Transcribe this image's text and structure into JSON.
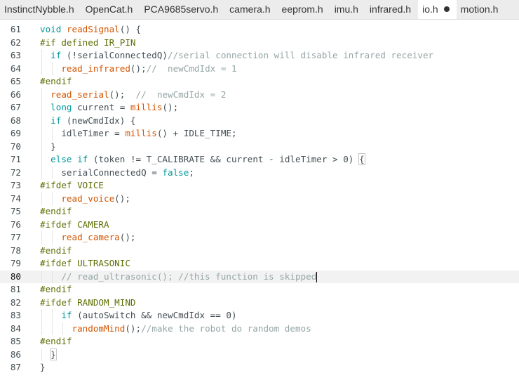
{
  "tabs": [
    {
      "label": "InstinctNybble.h",
      "active": false
    },
    {
      "label": "OpenCat.h",
      "active": false
    },
    {
      "label": "PCA9685servo.h",
      "active": false
    },
    {
      "label": "camera.h",
      "active": false
    },
    {
      "label": "eeprom.h",
      "active": false
    },
    {
      "label": "imu.h",
      "active": false
    },
    {
      "label": "infrared.h",
      "active": false
    },
    {
      "label": "io.h",
      "active": true,
      "modified": true
    },
    {
      "label": "motion.h",
      "active": false
    }
  ],
  "colors": {
    "keyword": "#00979c",
    "function": "#d35400",
    "preprocessor": "#5e6d03",
    "comment": "#95a5a6",
    "text": "#434f54",
    "current_line": "#f2f2f2"
  },
  "editor": {
    "current_line": 80,
    "lines": [
      {
        "n": "61",
        "indent": 0,
        "tokens": [
          [
            "kw",
            "void"
          ],
          [
            "t",
            " "
          ],
          [
            "fn",
            "readSignal"
          ],
          [
            "t",
            "() {"
          ]
        ]
      },
      {
        "n": "62",
        "indent": 0,
        "tokens": [
          [
            "pp",
            "#if defined IR_PIN"
          ]
        ]
      },
      {
        "n": "63",
        "indent": 1,
        "tokens": [
          [
            "kw",
            "if"
          ],
          [
            "t",
            " (!serialConnectedQ)"
          ],
          [
            "cm",
            "//serial connection will disable infrared receiver"
          ]
        ]
      },
      {
        "n": "64",
        "indent": 2,
        "tokens": [
          [
            "fn",
            "read_infrared"
          ],
          [
            "t",
            "();"
          ],
          [
            "cm",
            "//  newCmdIdx = 1"
          ]
        ]
      },
      {
        "n": "65",
        "indent": 0,
        "tokens": [
          [
            "pp",
            "#endif"
          ]
        ]
      },
      {
        "n": "66",
        "indent": 1,
        "tokens": [
          [
            "fn",
            "read_serial"
          ],
          [
            "t",
            "();  "
          ],
          [
            "cm",
            "//  newCmdIdx = 2"
          ]
        ]
      },
      {
        "n": "67",
        "indent": 1,
        "tokens": [
          [
            "kw",
            "long"
          ],
          [
            "t",
            " current = "
          ],
          [
            "fn",
            "millis"
          ],
          [
            "t",
            "();"
          ]
        ]
      },
      {
        "n": "68",
        "indent": 1,
        "tokens": [
          [
            "kw",
            "if"
          ],
          [
            "t",
            " (newCmdIdx) {"
          ]
        ]
      },
      {
        "n": "69",
        "indent": 2,
        "tokens": [
          [
            "t",
            "idleTimer = "
          ],
          [
            "fn",
            "millis"
          ],
          [
            "t",
            "() + IDLE_TIME;"
          ]
        ]
      },
      {
        "n": "70",
        "indent": 1,
        "tokens": [
          [
            "t",
            "}"
          ]
        ]
      },
      {
        "n": "71",
        "indent": 1,
        "tokens": [
          [
            "kw",
            "else"
          ],
          [
            "t",
            " "
          ],
          [
            "kw",
            "if"
          ],
          [
            "t",
            " (token != T_CALIBRATE && current - idleTimer > 0) "
          ],
          [
            "br",
            "{"
          ]
        ]
      },
      {
        "n": "72",
        "indent": 2,
        "tokens": [
          [
            "t",
            "serialConnectedQ = "
          ],
          [
            "kw",
            "false"
          ],
          [
            "t",
            ";"
          ]
        ]
      },
      {
        "n": "73",
        "indent": 0,
        "tokens": [
          [
            "pp",
            "#ifdef VOICE"
          ]
        ]
      },
      {
        "n": "74",
        "indent": 2,
        "tokens": [
          [
            "fn",
            "read_voice"
          ],
          [
            "t",
            "();"
          ]
        ]
      },
      {
        "n": "75",
        "indent": 0,
        "tokens": [
          [
            "pp",
            "#endif"
          ]
        ]
      },
      {
        "n": "76",
        "indent": 0,
        "tokens": [
          [
            "pp",
            "#ifdef CAMERA"
          ]
        ]
      },
      {
        "n": "77",
        "indent": 2,
        "tokens": [
          [
            "fn",
            "read_camera"
          ],
          [
            "t",
            "();"
          ]
        ]
      },
      {
        "n": "78",
        "indent": 0,
        "tokens": [
          [
            "pp",
            "#endif"
          ]
        ]
      },
      {
        "n": "79",
        "indent": 0,
        "tokens": [
          [
            "pp",
            "#ifdef ULTRASONIC"
          ]
        ]
      },
      {
        "n": "80",
        "indent": 2,
        "tokens": [
          [
            "cm",
            "// read_ultrasonic(); //this function is skipped"
          ],
          [
            "caret",
            ""
          ]
        ]
      },
      {
        "n": "81",
        "indent": 0,
        "tokens": [
          [
            "pp",
            "#endif"
          ]
        ]
      },
      {
        "n": "82",
        "indent": 0,
        "tokens": [
          [
            "pp",
            "#ifdef RANDOM_MIND"
          ]
        ]
      },
      {
        "n": "83",
        "indent": 2,
        "tokens": [
          [
            "kw",
            "if"
          ],
          [
            "t",
            " (autoSwitch && newCmdIdx == 0)"
          ]
        ]
      },
      {
        "n": "84",
        "indent": 3,
        "tokens": [
          [
            "fn",
            "randomMind"
          ],
          [
            "t",
            "();"
          ],
          [
            "cm",
            "//make the robot do random demos"
          ]
        ]
      },
      {
        "n": "85",
        "indent": 0,
        "tokens": [
          [
            "pp",
            "#endif"
          ]
        ]
      },
      {
        "n": "86",
        "indent": 1,
        "tokens": [
          [
            "br",
            "}"
          ]
        ]
      },
      {
        "n": "87",
        "indent": 0,
        "tokens": [
          [
            "t",
            "}"
          ]
        ]
      }
    ]
  }
}
